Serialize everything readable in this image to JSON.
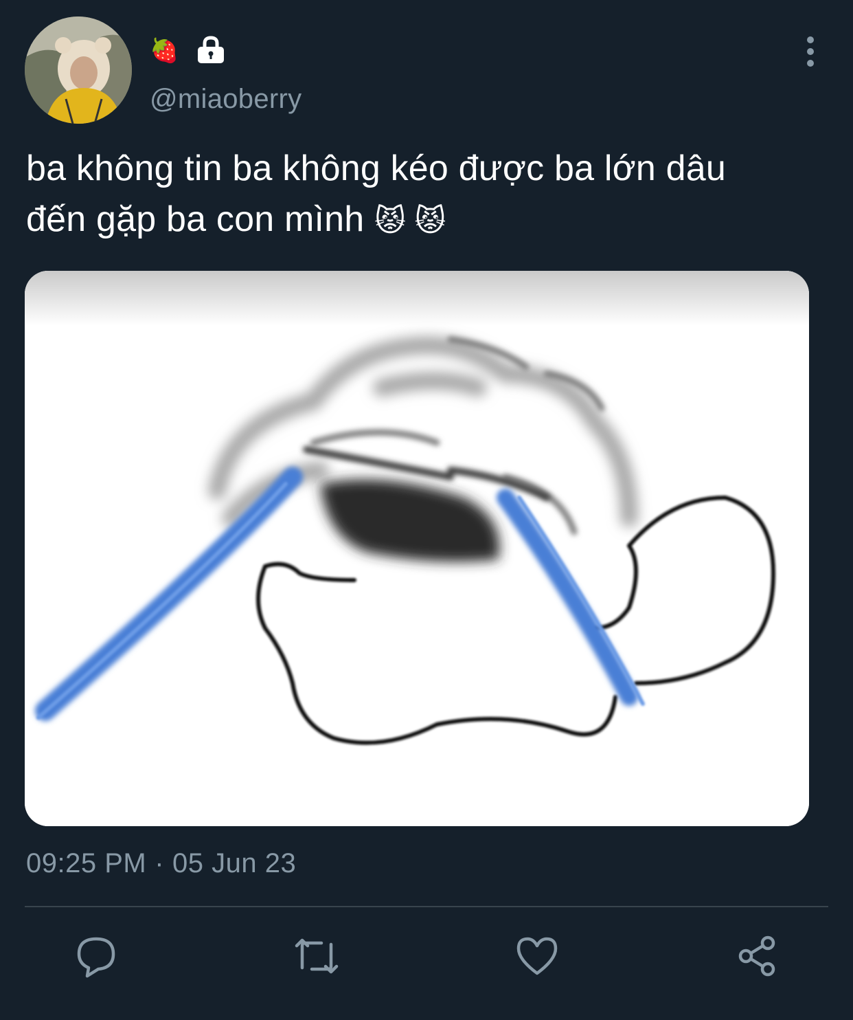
{
  "tweet": {
    "name_emoji": "🍓",
    "handle": "@miaoberry",
    "text_line1": "ba không tin ba không kéo được ba lớn dâu",
    "text_line2": "đến gặp ba con mình",
    "text_emoji": "😾 😾",
    "time": "09:25 PM",
    "separator": "·",
    "date": "05 Jun 23"
  },
  "icons": {
    "lock": "lock-icon",
    "more": "more-vertical-icon",
    "reply": "reply-icon",
    "retweet": "retweet-icon",
    "like": "heart-icon",
    "share": "share-icon"
  },
  "colors": {
    "background": "#15202b",
    "secondary_text": "#8899a6",
    "divider": "#38444d",
    "icon": "#8899a6"
  }
}
